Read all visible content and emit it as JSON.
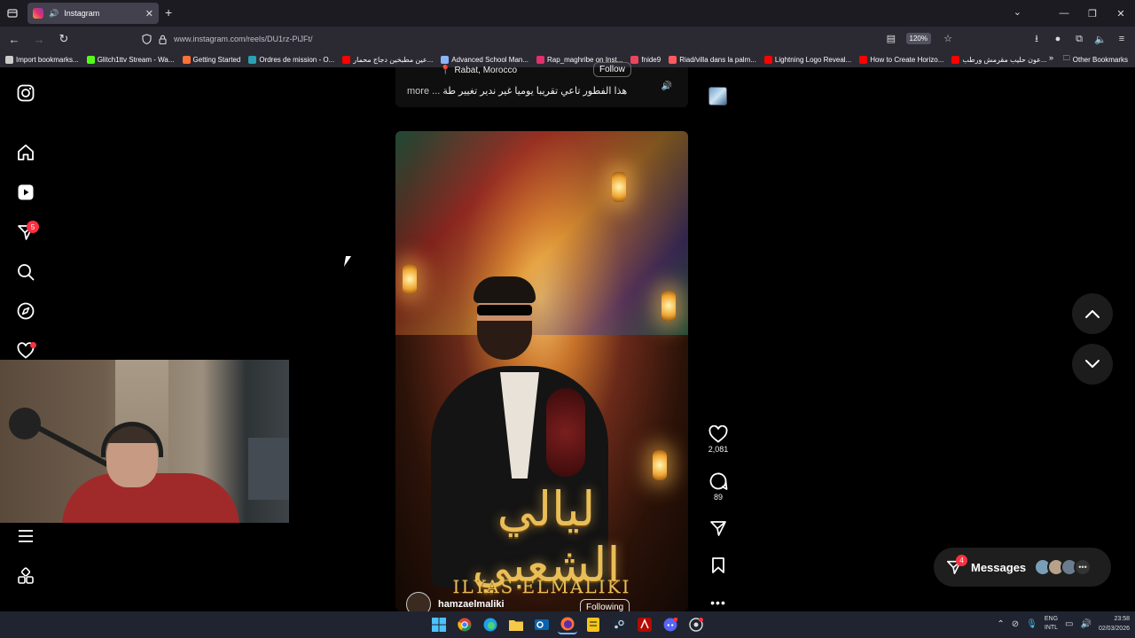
{
  "browser": {
    "tab_title": "Instagram",
    "url": "www.instagram.com/reels/DU1rz-PiJFt/",
    "zoom": "120%",
    "bookmarks": [
      {
        "label": "Import bookmarks...",
        "color": "#cccccc"
      },
      {
        "label": "Glitch1ttv Stream - Wa...",
        "color": "#53fc18"
      },
      {
        "label": "Getting Started",
        "color": "#ff7139"
      },
      {
        "label": "Ordres de mission - O...",
        "color": "#2aa0b5"
      },
      {
        "label": "عين مطبخين دجاج محمار...",
        "color": "#ff0000"
      },
      {
        "label": "Advanced School Man...",
        "color": "#8ab4f8"
      },
      {
        "label": "Rap_maghribe on Inst...",
        "color": "#e1306c"
      },
      {
        "label": "fnide9",
        "color": "#e94560"
      },
      {
        "label": "Riad/villa dans la palm...",
        "color": "#ff5a5f"
      },
      {
        "label": "Lightning Logo Reveal...",
        "color": "#ff0000"
      },
      {
        "label": "How to Create Horizo...",
        "color": "#ff0000"
      },
      {
        "label": "عون حليب مقرمش ورطب...",
        "color": "#ff0000"
      }
    ],
    "other_bookmarks": "Other Bookmarks"
  },
  "sidebar": {
    "notifications_count": "5"
  },
  "previous_post": {
    "location": "Rabat, Morocco",
    "follow_label": "Follow",
    "caption": "هذا الفطور تاعي تقريبا يوميا غير ندير تغيير طة",
    "more_label": "more ..."
  },
  "reel": {
    "title_arabic": "ليالي الشعبي",
    "title_latin": "ILYAS ELMALIKI",
    "username": "hamzaelmaliki",
    "following_label": "Following"
  },
  "actions": {
    "likes": "2,081",
    "comments": "89"
  },
  "messages": {
    "label": "Messages",
    "badge": "4"
  },
  "taskbar": {
    "lang_top": "ENG",
    "lang_bottom": "INTL",
    "time": "23:58",
    "date": "02/03/2026"
  },
  "colors": {
    "accent_badge": "#ff3040",
    "background": "#000000"
  }
}
